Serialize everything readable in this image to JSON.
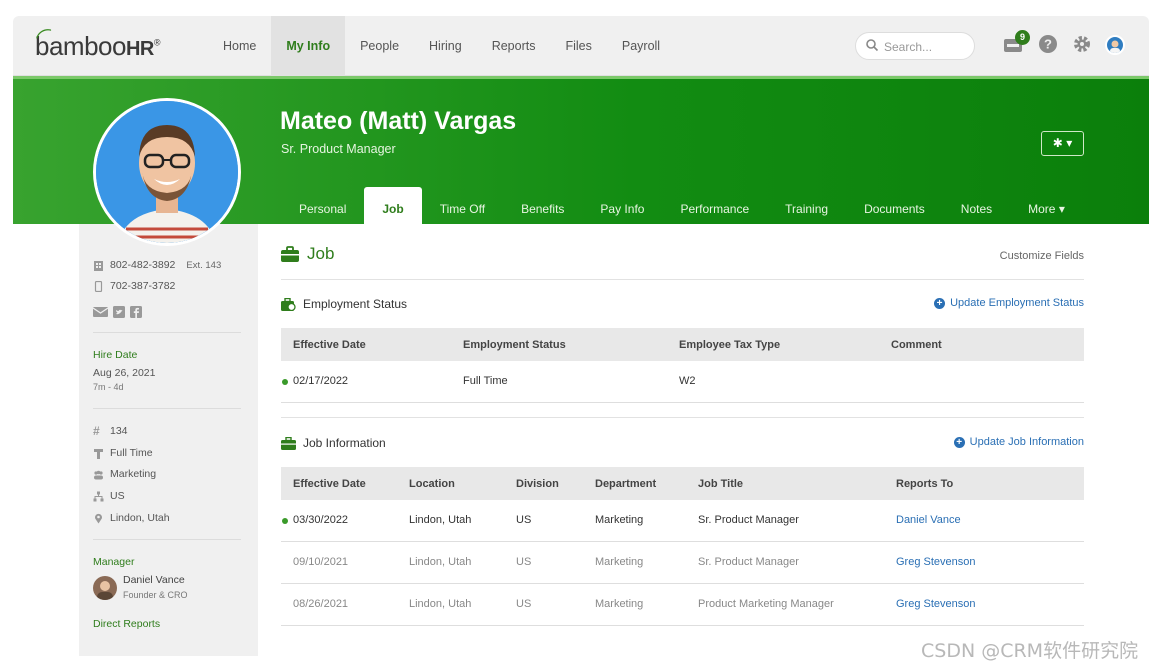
{
  "app": {
    "logo": {
      "main": "bamboo",
      "hr": "HR",
      "reg": "®"
    },
    "nav": [
      "Home",
      "My Info",
      "People",
      "Hiring",
      "Reports",
      "Files",
      "Payroll"
    ],
    "active_nav": "My Info",
    "search_placeholder": "Search...",
    "notifications_count": "9"
  },
  "employee": {
    "name": "Mateo (Matt) Vargas",
    "title": "Sr. Product Manager"
  },
  "tabs": [
    "Personal",
    "Job",
    "Time Off",
    "Benefits",
    "Pay Info",
    "Performance",
    "Training",
    "Documents",
    "Notes",
    "More ▾"
  ],
  "active_tab": "Job",
  "sidebar": {
    "work_phone": "802-482-3892",
    "ext": "Ext. 143",
    "mobile_phone": "702-387-3782",
    "hire_date_label": "Hire Date",
    "hire_date": "Aug 26, 2021",
    "tenure": "7m - 4d",
    "employee_number": "134",
    "employment_type": "Full Time",
    "department": "Marketing",
    "division": "US",
    "location": "Lindon, Utah",
    "manager_label": "Manager",
    "manager_name": "Daniel Vance",
    "manager_title": "Founder & CRO",
    "direct_reports_label": "Direct Reports"
  },
  "job": {
    "title": "Job",
    "customize": "Customize Fields",
    "employment_status": {
      "title": "Employment Status",
      "action": "Update Employment Status",
      "columns": [
        "Effective Date",
        "Employment Status",
        "Employee Tax Type",
        "Comment"
      ],
      "rows": [
        {
          "date": "02/17/2022",
          "status": "Full Time",
          "tax": "W2",
          "comment": ""
        }
      ]
    },
    "job_information": {
      "title": "Job Information",
      "action": "Update Job Information",
      "columns": [
        "Effective Date",
        "Location",
        "Division",
        "Department",
        "Job Title",
        "Reports To"
      ],
      "rows": [
        {
          "date": "03/30/2022",
          "location": "Lindon, Utah",
          "division": "US",
          "department": "Marketing",
          "job_title": "Sr. Product Manager",
          "reports_to": "Daniel Vance"
        },
        {
          "date": "09/10/2021",
          "location": "Lindon, Utah",
          "division": "US",
          "department": "Marketing",
          "job_title": "Sr. Product Manager",
          "reports_to": "Greg Stevenson"
        },
        {
          "date": "08/26/2021",
          "location": "Lindon, Utah",
          "division": "US",
          "department": "Marketing",
          "job_title": "Product Marketing Manager",
          "reports_to": "Greg Stevenson"
        }
      ]
    }
  },
  "watermark": "CSDN @CRM软件研究院",
  "colors": {
    "brand_green": "#2f7d1c",
    "link_blue": "#2a6fb4",
    "banner_dark": "#0b7f0b"
  }
}
